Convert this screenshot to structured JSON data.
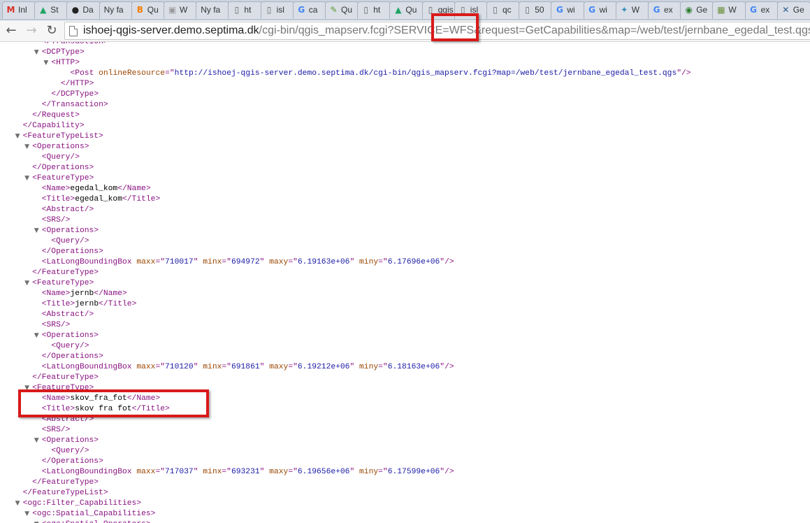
{
  "tabs": [
    {
      "label": "Inl",
      "icon": "gmail-icon",
      "glyph": "M",
      "color": "#d93025"
    },
    {
      "label": "St",
      "icon": "google-drive-icon",
      "glyph": "▲",
      "color": "#1fa463"
    },
    {
      "label": "Da",
      "icon": "github-icon",
      "glyph": "●",
      "color": "#222222"
    },
    {
      "label": "Ny fa",
      "icon": "",
      "glyph": "",
      "color": "#888888"
    },
    {
      "label": "Qu",
      "icon": "blogger-icon",
      "glyph": "B",
      "color": "#f57d00"
    },
    {
      "label": "W",
      "icon": "thumbnail-icon",
      "glyph": "▣",
      "color": "#999999"
    },
    {
      "label": "Ny fa",
      "icon": "",
      "glyph": "",
      "color": "#888888"
    },
    {
      "label": "ht",
      "icon": "page-icon",
      "glyph": "▯",
      "color": "#666666"
    },
    {
      "label": "isl",
      "icon": "page-icon",
      "glyph": "▯",
      "color": "#666666"
    },
    {
      "label": "ca",
      "icon": "google-icon",
      "glyph": "G",
      "color": "#4285f4"
    },
    {
      "label": "Qu",
      "icon": "pencil-icon",
      "glyph": "✎",
      "color": "#5a9e2f"
    },
    {
      "label": "ht",
      "icon": "page-icon",
      "glyph": "▯",
      "color": "#666666"
    },
    {
      "label": "Qu",
      "icon": "google-drive-icon",
      "glyph": "▲",
      "color": "#1fa463"
    },
    {
      "label": "qgis",
      "icon": "page-icon",
      "glyph": "▯",
      "color": "#666666"
    },
    {
      "label": "isl",
      "icon": "page-icon",
      "glyph": "▯",
      "color": "#666666"
    },
    {
      "label": "qc",
      "icon": "page-icon",
      "glyph": "▯",
      "color": "#666666"
    },
    {
      "label": "50",
      "icon": "page-icon",
      "glyph": "▯",
      "color": "#666666"
    },
    {
      "label": "wi",
      "icon": "google-icon",
      "glyph": "G",
      "color": "#4285f4"
    },
    {
      "label": "wi",
      "icon": "google-icon",
      "glyph": "G",
      "color": "#4285f4"
    },
    {
      "label": "W",
      "icon": "globe-icon",
      "glyph": "✦",
      "color": "#3a8fb7"
    },
    {
      "label": "ex",
      "icon": "google-icon",
      "glyph": "G",
      "color": "#4285f4"
    },
    {
      "label": "Ge",
      "icon": "osgeo-icon",
      "glyph": "◉",
      "color": "#2e7d32"
    },
    {
      "label": "W",
      "icon": "map-icon",
      "glyph": "▦",
      "color": "#6a8f3a"
    },
    {
      "label": "ex",
      "icon": "google-icon",
      "glyph": "G",
      "color": "#4285f4"
    },
    {
      "label": "Ge",
      "icon": "tools-icon",
      "glyph": "✕",
      "color": "#2b5d8f"
    }
  ],
  "toolbar": {
    "back": "←",
    "forward": "→",
    "reload": "↻"
  },
  "url": {
    "host": "ishoej-qgis-server.demo.septima.dk",
    "path": "/cgi-bin/qgis_mapserv.fcgi?SERVICE=WFS&request=GetCapabilities&map=/web/test/jernbane_egedal_test.qgs"
  },
  "xml_lines": [
    {
      "indent": 6,
      "arrow": "",
      "segments": [
        {
          "c": "tg",
          "t": "</Transaction>"
        }
      ]
    },
    {
      "indent": 6,
      "arrow": "▼",
      "segments": [
        {
          "c": "tg",
          "t": "<DCPType>"
        }
      ]
    },
    {
      "indent": 8,
      "arrow": "▼",
      "segments": [
        {
          "c": "tg",
          "t": "<HTTP>"
        }
      ]
    },
    {
      "indent": 12,
      "arrow": "",
      "segments": [
        {
          "c": "tg",
          "t": "<Post "
        },
        {
          "c": "an",
          "t": "onlineResource"
        },
        {
          "c": "tg",
          "t": "=\""
        },
        {
          "c": "av",
          "t": "http://ishoej-qgis-server.demo.septima.dk/cgi-bin/qgis_mapserv.fcgi?map=/web/test/jernbane_egedal_test.qgs"
        },
        {
          "c": "tg",
          "t": "\"/>"
        }
      ]
    },
    {
      "indent": 10,
      "arrow": "",
      "segments": [
        {
          "c": "tg",
          "t": "</HTTP>"
        }
      ]
    },
    {
      "indent": 8,
      "arrow": "",
      "segments": [
        {
          "c": "tg",
          "t": "</DCPType>"
        }
      ]
    },
    {
      "indent": 6,
      "arrow": "",
      "segments": [
        {
          "c": "tg",
          "t": "</Transaction>"
        }
      ]
    },
    {
      "indent": 4,
      "arrow": "",
      "segments": [
        {
          "c": "tg",
          "t": "</Request>"
        }
      ]
    },
    {
      "indent": 2,
      "arrow": "",
      "segments": [
        {
          "c": "tg",
          "t": "</Capability>"
        }
      ]
    },
    {
      "indent": 2,
      "arrow": "▼",
      "segments": [
        {
          "c": "tg",
          "t": "<FeatureTypeList>"
        }
      ]
    },
    {
      "indent": 4,
      "arrow": "▼",
      "segments": [
        {
          "c": "tg",
          "t": "<Operations>"
        }
      ]
    },
    {
      "indent": 6,
      "arrow": "",
      "segments": [
        {
          "c": "tg",
          "t": "<Query/>"
        }
      ]
    },
    {
      "indent": 4,
      "arrow": "",
      "segments": [
        {
          "c": "tg",
          "t": "</Operations>"
        }
      ]
    },
    {
      "indent": 4,
      "arrow": "▼",
      "segments": [
        {
          "c": "tg",
          "t": "<FeatureType>"
        }
      ]
    },
    {
      "indent": 6,
      "arrow": "",
      "segments": [
        {
          "c": "tg",
          "t": "<Name>"
        },
        {
          "c": "tx",
          "t": "egedal_kom"
        },
        {
          "c": "tg",
          "t": "</Name>"
        }
      ]
    },
    {
      "indent": 6,
      "arrow": "",
      "segments": [
        {
          "c": "tg",
          "t": "<Title>"
        },
        {
          "c": "tx",
          "t": "egedal_kom"
        },
        {
          "c": "tg",
          "t": "</Title>"
        }
      ]
    },
    {
      "indent": 6,
      "arrow": "",
      "segments": [
        {
          "c": "tg",
          "t": "<Abstract/>"
        }
      ]
    },
    {
      "indent": 6,
      "arrow": "",
      "segments": [
        {
          "c": "tg",
          "t": "<SRS/>"
        }
      ]
    },
    {
      "indent": 6,
      "arrow": "▼",
      "segments": [
        {
          "c": "tg",
          "t": "<Operations>"
        }
      ]
    },
    {
      "indent": 8,
      "arrow": "",
      "segments": [
        {
          "c": "tg",
          "t": "<Query/>"
        }
      ]
    },
    {
      "indent": 6,
      "arrow": "",
      "segments": [
        {
          "c": "tg",
          "t": "</Operations>"
        }
      ]
    },
    {
      "indent": 6,
      "arrow": "",
      "segments": [
        {
          "c": "tg",
          "t": "<LatLongBoundingBox "
        },
        {
          "c": "an",
          "t": "maxx"
        },
        {
          "c": "tg",
          "t": "=\""
        },
        {
          "c": "av",
          "t": "710017"
        },
        {
          "c": "tg",
          "t": "\" "
        },
        {
          "c": "an",
          "t": "minx"
        },
        {
          "c": "tg",
          "t": "=\""
        },
        {
          "c": "av",
          "t": "694972"
        },
        {
          "c": "tg",
          "t": "\" "
        },
        {
          "c": "an",
          "t": "maxy"
        },
        {
          "c": "tg",
          "t": "=\""
        },
        {
          "c": "av",
          "t": "6.19163e+06"
        },
        {
          "c": "tg",
          "t": "\" "
        },
        {
          "c": "an",
          "t": "miny"
        },
        {
          "c": "tg",
          "t": "=\""
        },
        {
          "c": "av",
          "t": "6.17696e+06"
        },
        {
          "c": "tg",
          "t": "\"/>"
        }
      ]
    },
    {
      "indent": 4,
      "arrow": "",
      "segments": [
        {
          "c": "tg",
          "t": "</FeatureType>"
        }
      ]
    },
    {
      "indent": 4,
      "arrow": "▼",
      "segments": [
        {
          "c": "tg",
          "t": "<FeatureType>"
        }
      ]
    },
    {
      "indent": 6,
      "arrow": "",
      "segments": [
        {
          "c": "tg",
          "t": "<Name>"
        },
        {
          "c": "tx",
          "t": "jernb"
        },
        {
          "c": "tg",
          "t": "</Name>"
        }
      ]
    },
    {
      "indent": 6,
      "arrow": "",
      "segments": [
        {
          "c": "tg",
          "t": "<Title>"
        },
        {
          "c": "tx",
          "t": "jernb"
        },
        {
          "c": "tg",
          "t": "</Title>"
        }
      ]
    },
    {
      "indent": 6,
      "arrow": "",
      "segments": [
        {
          "c": "tg",
          "t": "<Abstract/>"
        }
      ]
    },
    {
      "indent": 6,
      "arrow": "",
      "segments": [
        {
          "c": "tg",
          "t": "<SRS/>"
        }
      ]
    },
    {
      "indent": 6,
      "arrow": "▼",
      "segments": [
        {
          "c": "tg",
          "t": "<Operations>"
        }
      ]
    },
    {
      "indent": 8,
      "arrow": "",
      "segments": [
        {
          "c": "tg",
          "t": "<Query/>"
        }
      ]
    },
    {
      "indent": 6,
      "arrow": "",
      "segments": [
        {
          "c": "tg",
          "t": "</Operations>"
        }
      ]
    },
    {
      "indent": 6,
      "arrow": "",
      "segments": [
        {
          "c": "tg",
          "t": "<LatLongBoundingBox "
        },
        {
          "c": "an",
          "t": "maxx"
        },
        {
          "c": "tg",
          "t": "=\""
        },
        {
          "c": "av",
          "t": "710120"
        },
        {
          "c": "tg",
          "t": "\" "
        },
        {
          "c": "an",
          "t": "minx"
        },
        {
          "c": "tg",
          "t": "=\""
        },
        {
          "c": "av",
          "t": "691861"
        },
        {
          "c": "tg",
          "t": "\" "
        },
        {
          "c": "an",
          "t": "maxy"
        },
        {
          "c": "tg",
          "t": "=\""
        },
        {
          "c": "av",
          "t": "6.19212e+06"
        },
        {
          "c": "tg",
          "t": "\" "
        },
        {
          "c": "an",
          "t": "miny"
        },
        {
          "c": "tg",
          "t": "=\""
        },
        {
          "c": "av",
          "t": "6.18163e+06"
        },
        {
          "c": "tg",
          "t": "\"/>"
        }
      ]
    },
    {
      "indent": 4,
      "arrow": "",
      "segments": [
        {
          "c": "tg",
          "t": "</FeatureType>"
        }
      ]
    },
    {
      "indent": 4,
      "arrow": "▼",
      "segments": [
        {
          "c": "tg",
          "t": "<FeatureType>"
        }
      ]
    },
    {
      "indent": 6,
      "arrow": "",
      "segments": [
        {
          "c": "tg",
          "t": "<Name>"
        },
        {
          "c": "tx",
          "t": "skov_fra_fot"
        },
        {
          "c": "tg",
          "t": "</Name>"
        }
      ]
    },
    {
      "indent": 6,
      "arrow": "",
      "segments": [
        {
          "c": "tg",
          "t": "<Title>"
        },
        {
          "c": "tx",
          "t": "skov fra fot"
        },
        {
          "c": "tg",
          "t": "</Title>"
        }
      ]
    },
    {
      "indent": 6,
      "arrow": "",
      "segments": [
        {
          "c": "tg",
          "t": "<Abstract/>"
        }
      ]
    },
    {
      "indent": 6,
      "arrow": "",
      "segments": [
        {
          "c": "tg",
          "t": "<SRS/>"
        }
      ]
    },
    {
      "indent": 6,
      "arrow": "▼",
      "segments": [
        {
          "c": "tg",
          "t": "<Operations>"
        }
      ]
    },
    {
      "indent": 8,
      "arrow": "",
      "segments": [
        {
          "c": "tg",
          "t": "<Query/>"
        }
      ]
    },
    {
      "indent": 6,
      "arrow": "",
      "segments": [
        {
          "c": "tg",
          "t": "</Operations>"
        }
      ]
    },
    {
      "indent": 6,
      "arrow": "",
      "segments": [
        {
          "c": "tg",
          "t": "<LatLongBoundingBox "
        },
        {
          "c": "an",
          "t": "maxx"
        },
        {
          "c": "tg",
          "t": "=\""
        },
        {
          "c": "av",
          "t": "717037"
        },
        {
          "c": "tg",
          "t": "\" "
        },
        {
          "c": "an",
          "t": "minx"
        },
        {
          "c": "tg",
          "t": "=\""
        },
        {
          "c": "av",
          "t": "693231"
        },
        {
          "c": "tg",
          "t": "\" "
        },
        {
          "c": "an",
          "t": "maxy"
        },
        {
          "c": "tg",
          "t": "=\""
        },
        {
          "c": "av",
          "t": "6.19656e+06"
        },
        {
          "c": "tg",
          "t": "\" "
        },
        {
          "c": "an",
          "t": "miny"
        },
        {
          "c": "tg",
          "t": "=\""
        },
        {
          "c": "av",
          "t": "6.17599e+06"
        },
        {
          "c": "tg",
          "t": "\"/>"
        }
      ]
    },
    {
      "indent": 4,
      "arrow": "",
      "segments": [
        {
          "c": "tg",
          "t": "</FeatureType>"
        }
      ]
    },
    {
      "indent": 2,
      "arrow": "",
      "segments": [
        {
          "c": "tg",
          "t": "</FeatureTypeList>"
        }
      ]
    },
    {
      "indent": 2,
      "arrow": "▼",
      "segments": [
        {
          "c": "tg",
          "t": "<ogc:Filter_Capabilities>"
        }
      ]
    },
    {
      "indent": 4,
      "arrow": "▼",
      "segments": [
        {
          "c": "tg",
          "t": "<ogc:Spatial_Capabilities>"
        }
      ]
    },
    {
      "indent": 6,
      "arrow": "▼",
      "segments": [
        {
          "c": "tg",
          "t": "<ogc:Spatial_Operators>"
        }
      ]
    }
  ],
  "colors": {
    "tag": "#881280",
    "attr_name": "#994500",
    "attr_value": "#1a1aa6",
    "annotation": "#d81a1a"
  }
}
